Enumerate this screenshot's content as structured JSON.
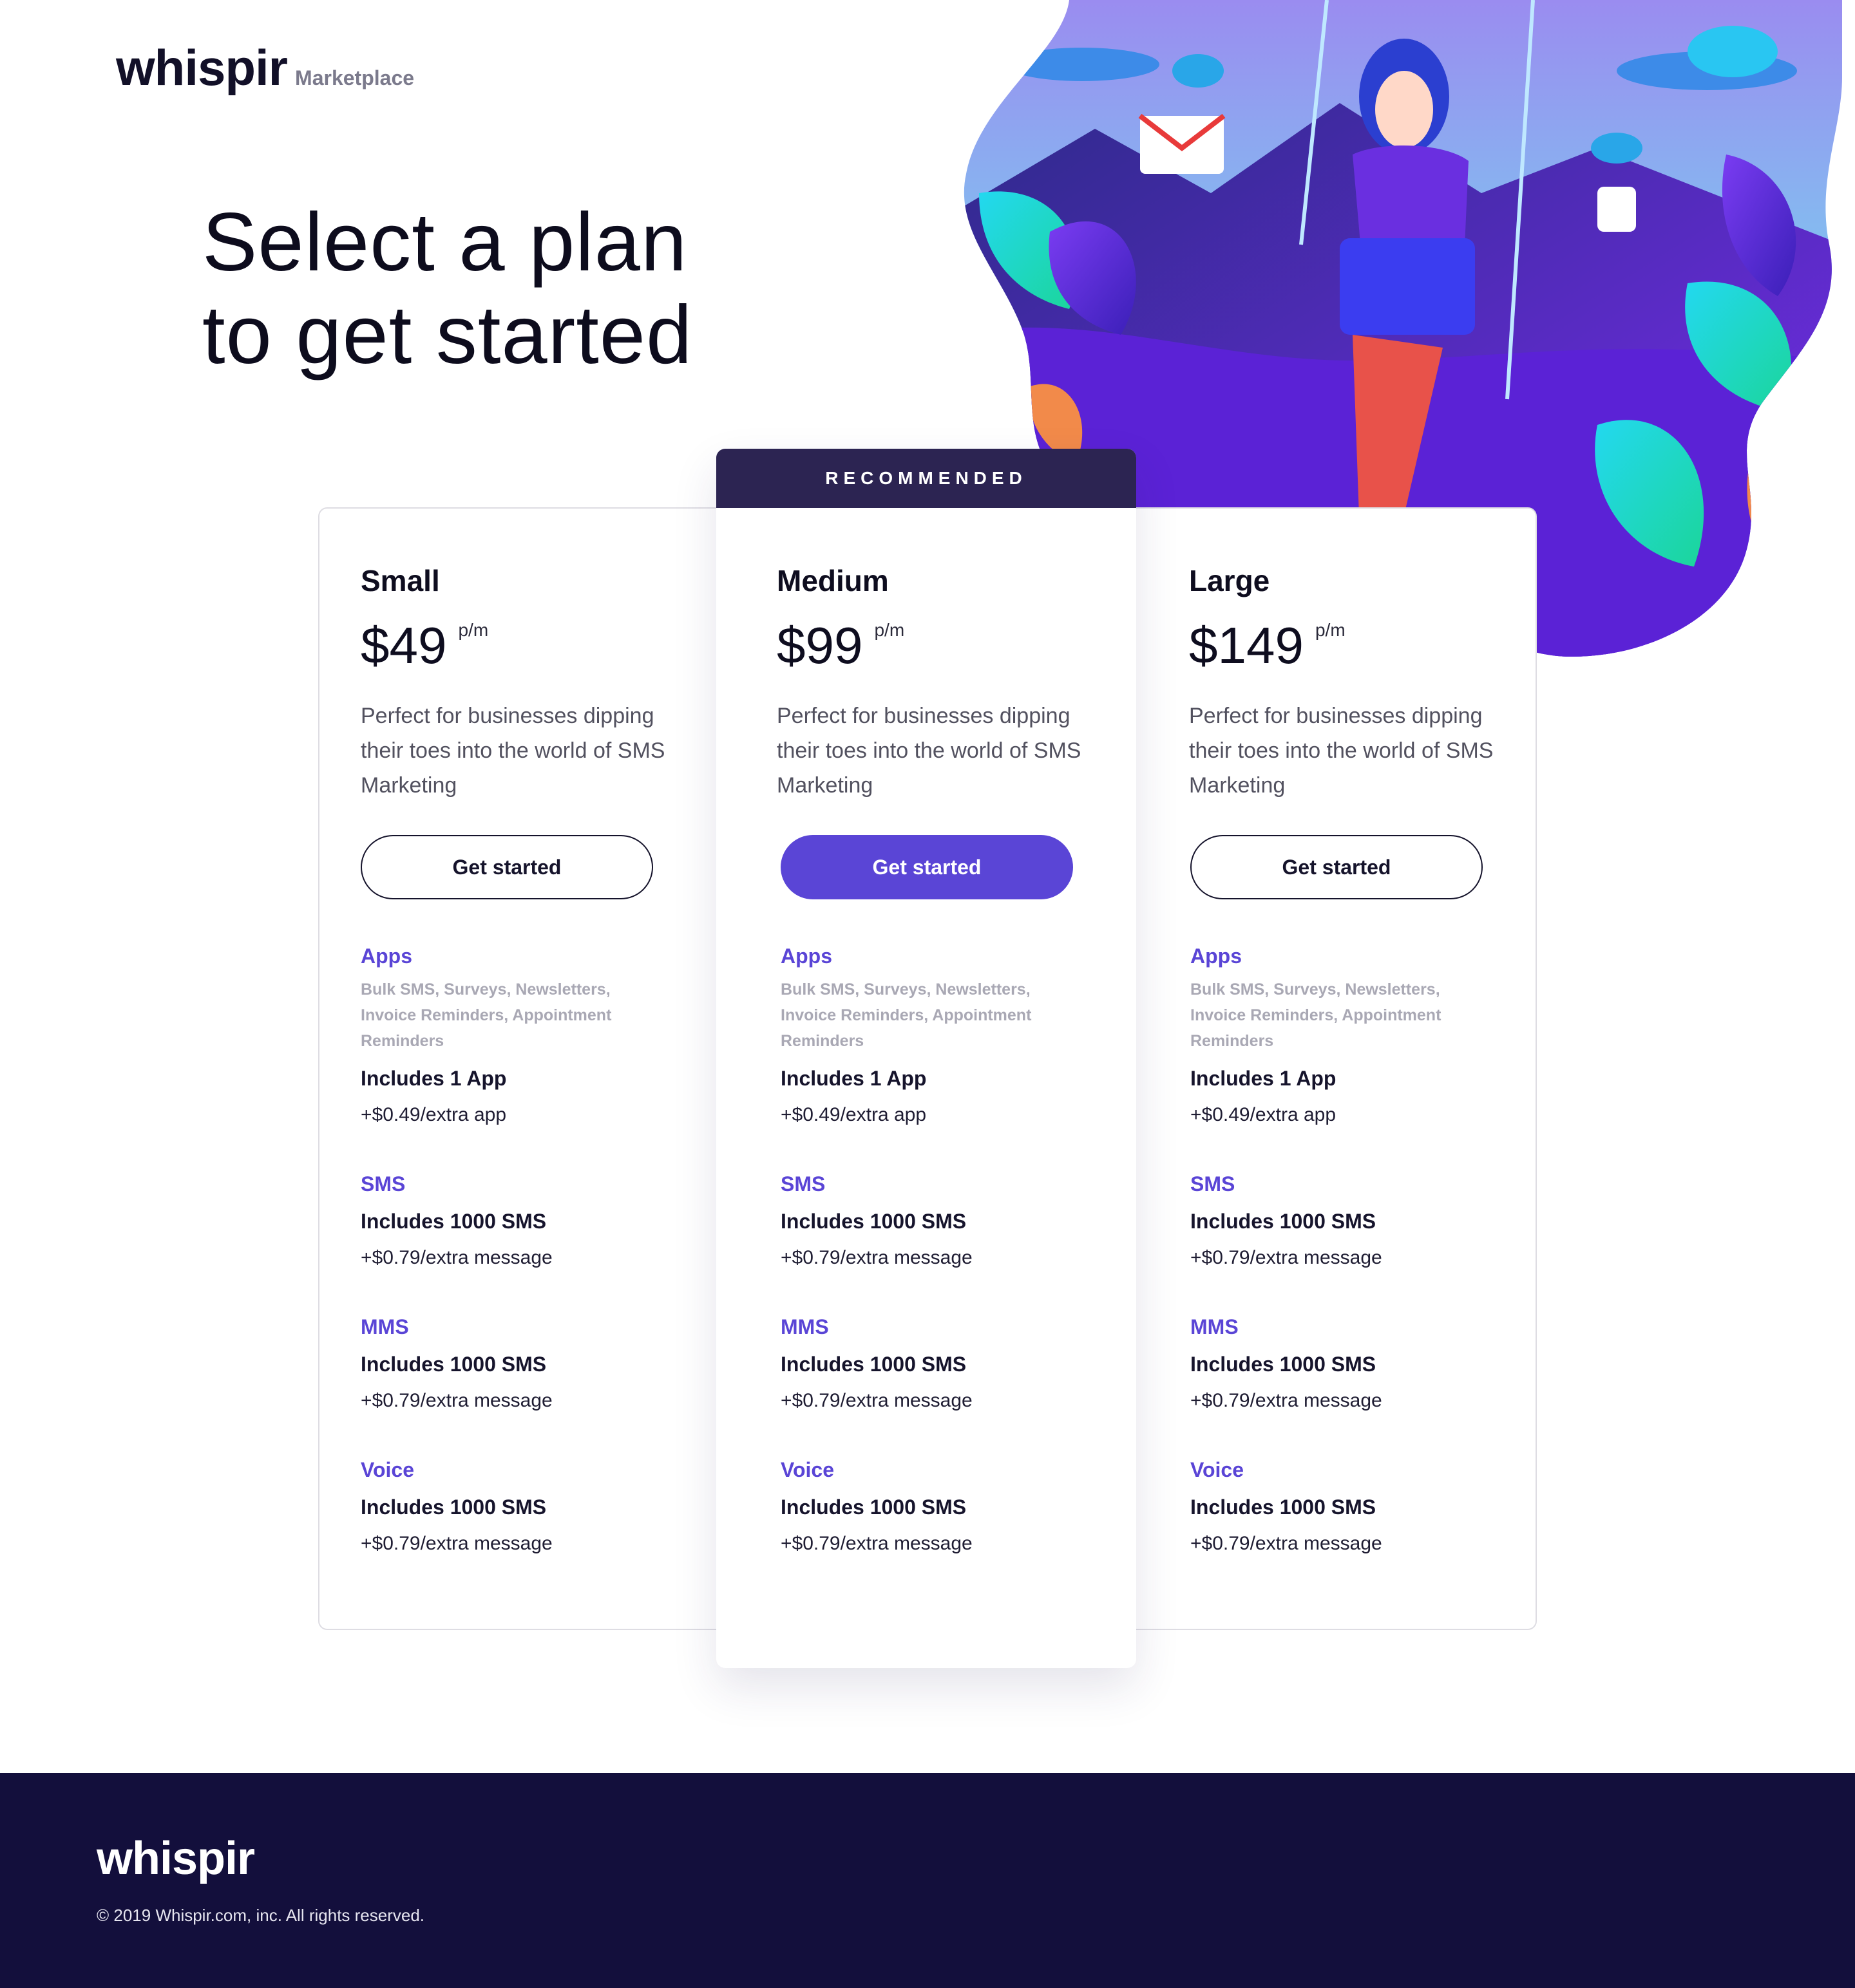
{
  "header": {
    "brand": "whispir",
    "brand_sub": "Marketplace",
    "title_line1": "Select a plan",
    "title_line2": "to get started"
  },
  "colors": {
    "accent": "#5a45d6",
    "dark_navy": "#130f3c",
    "recommended_bg": "#2c2452"
  },
  "recommended_label": "RECOMMENDED",
  "plans": [
    {
      "name": "Small",
      "price": "$49",
      "period": "p/m",
      "description": "Perfect for businesses dipping their toes into the world of SMS Marketing",
      "cta": "Get started",
      "featured": false,
      "features": {
        "apps_title": "Apps",
        "apps_list": "Bulk SMS, Surveys, Newsletters, Invoice Reminders, Appointment Reminders",
        "apps_includes": "Includes 1 App",
        "apps_extra": "+$0.49/extra app",
        "sms_title": "SMS",
        "sms_includes": "Includes 1000 SMS",
        "sms_extra": "+$0.79/extra message",
        "mms_title": "MMS",
        "mms_includes": "Includes 1000 SMS",
        "mms_extra": "+$0.79/extra message",
        "voice_title": "Voice",
        "voice_includes": "Includes 1000 SMS",
        "voice_extra": "+$0.79/extra message"
      }
    },
    {
      "name": "Medium",
      "price": "$99",
      "period": "p/m",
      "description": "Perfect for businesses dipping their toes into the world of SMS Marketing",
      "cta": "Get started",
      "featured": true,
      "features": {
        "apps_title": "Apps",
        "apps_list": "Bulk SMS, Surveys, Newsletters, Invoice Reminders, Appointment Reminders",
        "apps_includes": "Includes 1 App",
        "apps_extra": "+$0.49/extra app",
        "sms_title": "SMS",
        "sms_includes": "Includes 1000 SMS",
        "sms_extra": "+$0.79/extra message",
        "mms_title": "MMS",
        "mms_includes": "Includes 1000 SMS",
        "mms_extra": "+$0.79/extra message",
        "voice_title": "Voice",
        "voice_includes": "Includes 1000 SMS",
        "voice_extra": "+$0.79/extra message"
      }
    },
    {
      "name": "Large",
      "price": "$149",
      "period": "p/m",
      "description": "Perfect for businesses dipping their toes into the world of SMS Marketing",
      "cta": "Get started",
      "featured": false,
      "features": {
        "apps_title": "Apps",
        "apps_list": "Bulk SMS, Surveys, Newsletters, Invoice Reminders, Appointment Reminders",
        "apps_includes": "Includes 1 App",
        "apps_extra": "+$0.49/extra app",
        "sms_title": "SMS",
        "sms_includes": "Includes 1000 SMS",
        "sms_extra": "+$0.79/extra message",
        "mms_title": "MMS",
        "mms_includes": "Includes 1000 SMS",
        "mms_extra": "+$0.79/extra message",
        "voice_title": "Voice",
        "voice_includes": "Includes 1000 SMS",
        "voice_extra": "+$0.79/extra message"
      }
    }
  ],
  "footer": {
    "brand": "whispir",
    "copyright": "© 2019 Whispir.com, inc. All rights reserved."
  }
}
